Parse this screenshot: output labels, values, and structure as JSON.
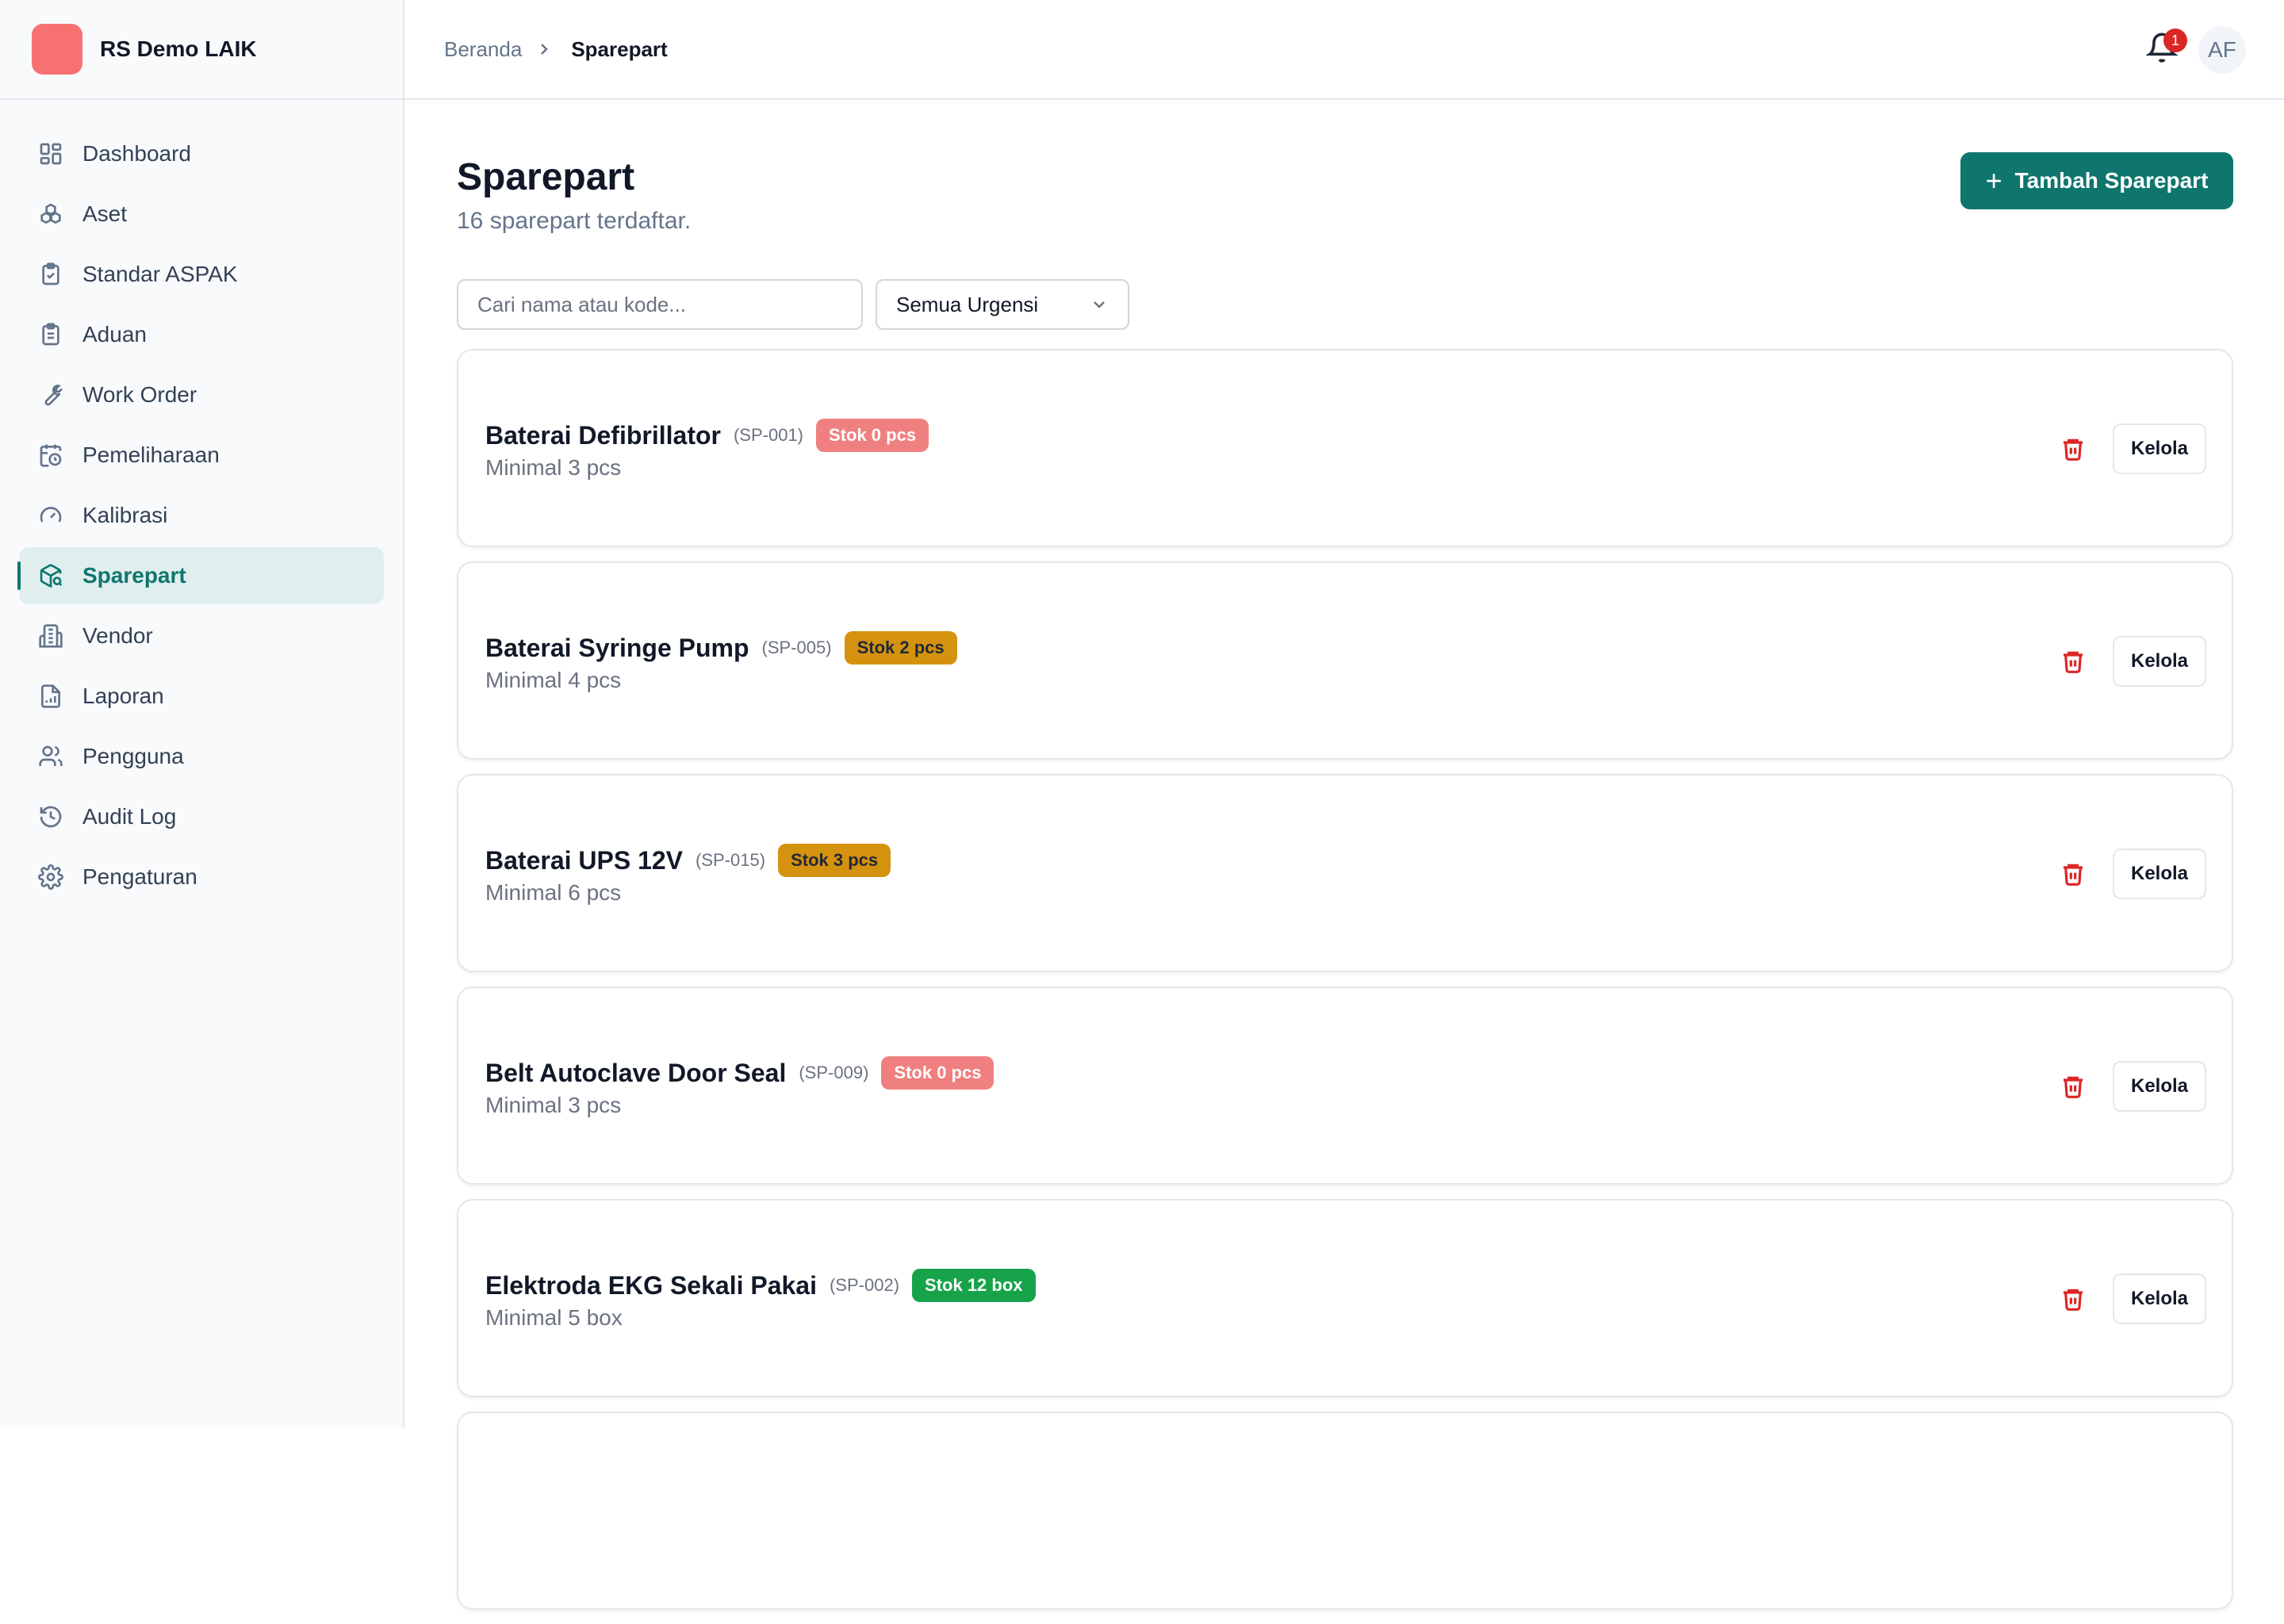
{
  "brand": {
    "name": "RS Demo LAIK",
    "logo_color": "#f87171"
  },
  "sidebar": {
    "items": [
      {
        "label": "Dashboard",
        "icon": "dashboard-icon"
      },
      {
        "label": "Aset",
        "icon": "assets-icon"
      },
      {
        "label": "Standar ASPAK",
        "icon": "clipboard-check-icon"
      },
      {
        "label": "Aduan",
        "icon": "clipboard-list-icon"
      },
      {
        "label": "Work Order",
        "icon": "wrench-icon"
      },
      {
        "label": "Pemeliharaan",
        "icon": "calendar-clock-icon"
      },
      {
        "label": "Kalibrasi",
        "icon": "gauge-icon"
      },
      {
        "label": "Sparepart",
        "icon": "package-search-icon",
        "active": true
      },
      {
        "label": "Vendor",
        "icon": "building-icon"
      },
      {
        "label": "Laporan",
        "icon": "file-chart-icon"
      },
      {
        "label": "Pengguna",
        "icon": "users-icon"
      },
      {
        "label": "Audit Log",
        "icon": "history-icon"
      },
      {
        "label": "Pengaturan",
        "icon": "settings-icon"
      }
    ],
    "accent_color": "#0f766e"
  },
  "header": {
    "breadcrumb_home": "Beranda",
    "breadcrumb_current": "Sparepart",
    "notification_count": "1",
    "avatar_initials": "AF"
  },
  "main": {
    "title": "Sparepart",
    "subtitle": "16 sparepart terdaftar.",
    "add_button_label": "Tambah Sparepart",
    "search_placeholder": "Cari nama atau kode...",
    "urgency_filter_value": "Semua Urgensi",
    "items": [
      {
        "name": "Baterai Defibrillator",
        "code": "(SP-001)",
        "stock": "Stok 0 pcs",
        "stock_status": "red",
        "minimum": "Minimal 3 pcs",
        "action": "Kelola"
      },
      {
        "name": "Baterai Syringe Pump",
        "code": "(SP-005)",
        "stock": "Stok 2 pcs",
        "stock_status": "amber",
        "minimum": "Minimal 4 pcs",
        "action": "Kelola"
      },
      {
        "name": "Baterai UPS 12V",
        "code": "(SP-015)",
        "stock": "Stok 3 pcs",
        "stock_status": "amber",
        "minimum": "Minimal 6 pcs",
        "action": "Kelola"
      },
      {
        "name": "Belt Autoclave Door Seal",
        "code": "(SP-009)",
        "stock": "Stok 0 pcs",
        "stock_status": "red",
        "minimum": "Minimal 3 pcs",
        "action": "Kelola"
      },
      {
        "name": "Elektroda EKG Sekali Pakai",
        "code": "(SP-002)",
        "stock": "Stok 12 box",
        "stock_status": "green",
        "minimum": "Minimal 5 box",
        "action": "Kelola"
      }
    ]
  }
}
